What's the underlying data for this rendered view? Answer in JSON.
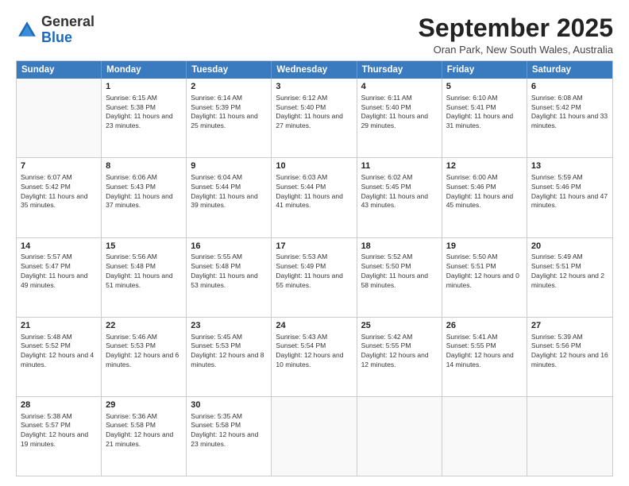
{
  "header": {
    "logo_general": "General",
    "logo_blue": "Blue",
    "month_title": "September 2025",
    "location": "Oran Park, New South Wales, Australia"
  },
  "days_of_week": [
    "Sunday",
    "Monday",
    "Tuesday",
    "Wednesday",
    "Thursday",
    "Friday",
    "Saturday"
  ],
  "weeks": [
    [
      {
        "day": "",
        "empty": true
      },
      {
        "day": "1",
        "sunrise": "Sunrise: 6:15 AM",
        "sunset": "Sunset: 5:38 PM",
        "daylight": "Daylight: 11 hours and 23 minutes."
      },
      {
        "day": "2",
        "sunrise": "Sunrise: 6:14 AM",
        "sunset": "Sunset: 5:39 PM",
        "daylight": "Daylight: 11 hours and 25 minutes."
      },
      {
        "day": "3",
        "sunrise": "Sunrise: 6:12 AM",
        "sunset": "Sunset: 5:40 PM",
        "daylight": "Daylight: 11 hours and 27 minutes."
      },
      {
        "day": "4",
        "sunrise": "Sunrise: 6:11 AM",
        "sunset": "Sunset: 5:40 PM",
        "daylight": "Daylight: 11 hours and 29 minutes."
      },
      {
        "day": "5",
        "sunrise": "Sunrise: 6:10 AM",
        "sunset": "Sunset: 5:41 PM",
        "daylight": "Daylight: 11 hours and 31 minutes."
      },
      {
        "day": "6",
        "sunrise": "Sunrise: 6:08 AM",
        "sunset": "Sunset: 5:42 PM",
        "daylight": "Daylight: 11 hours and 33 minutes."
      }
    ],
    [
      {
        "day": "7",
        "sunrise": "Sunrise: 6:07 AM",
        "sunset": "Sunset: 5:42 PM",
        "daylight": "Daylight: 11 hours and 35 minutes."
      },
      {
        "day": "8",
        "sunrise": "Sunrise: 6:06 AM",
        "sunset": "Sunset: 5:43 PM",
        "daylight": "Daylight: 11 hours and 37 minutes."
      },
      {
        "day": "9",
        "sunrise": "Sunrise: 6:04 AM",
        "sunset": "Sunset: 5:44 PM",
        "daylight": "Daylight: 11 hours and 39 minutes."
      },
      {
        "day": "10",
        "sunrise": "Sunrise: 6:03 AM",
        "sunset": "Sunset: 5:44 PM",
        "daylight": "Daylight: 11 hours and 41 minutes."
      },
      {
        "day": "11",
        "sunrise": "Sunrise: 6:02 AM",
        "sunset": "Sunset: 5:45 PM",
        "daylight": "Daylight: 11 hours and 43 minutes."
      },
      {
        "day": "12",
        "sunrise": "Sunrise: 6:00 AM",
        "sunset": "Sunset: 5:46 PM",
        "daylight": "Daylight: 11 hours and 45 minutes."
      },
      {
        "day": "13",
        "sunrise": "Sunrise: 5:59 AM",
        "sunset": "Sunset: 5:46 PM",
        "daylight": "Daylight: 11 hours and 47 minutes."
      }
    ],
    [
      {
        "day": "14",
        "sunrise": "Sunrise: 5:57 AM",
        "sunset": "Sunset: 5:47 PM",
        "daylight": "Daylight: 11 hours and 49 minutes."
      },
      {
        "day": "15",
        "sunrise": "Sunrise: 5:56 AM",
        "sunset": "Sunset: 5:48 PM",
        "daylight": "Daylight: 11 hours and 51 minutes."
      },
      {
        "day": "16",
        "sunrise": "Sunrise: 5:55 AM",
        "sunset": "Sunset: 5:48 PM",
        "daylight": "Daylight: 11 hours and 53 minutes."
      },
      {
        "day": "17",
        "sunrise": "Sunrise: 5:53 AM",
        "sunset": "Sunset: 5:49 PM",
        "daylight": "Daylight: 11 hours and 55 minutes."
      },
      {
        "day": "18",
        "sunrise": "Sunrise: 5:52 AM",
        "sunset": "Sunset: 5:50 PM",
        "daylight": "Daylight: 11 hours and 58 minutes."
      },
      {
        "day": "19",
        "sunrise": "Sunrise: 5:50 AM",
        "sunset": "Sunset: 5:51 PM",
        "daylight": "Daylight: 12 hours and 0 minutes."
      },
      {
        "day": "20",
        "sunrise": "Sunrise: 5:49 AM",
        "sunset": "Sunset: 5:51 PM",
        "daylight": "Daylight: 12 hours and 2 minutes."
      }
    ],
    [
      {
        "day": "21",
        "sunrise": "Sunrise: 5:48 AM",
        "sunset": "Sunset: 5:52 PM",
        "daylight": "Daylight: 12 hours and 4 minutes."
      },
      {
        "day": "22",
        "sunrise": "Sunrise: 5:46 AM",
        "sunset": "Sunset: 5:53 PM",
        "daylight": "Daylight: 12 hours and 6 minutes."
      },
      {
        "day": "23",
        "sunrise": "Sunrise: 5:45 AM",
        "sunset": "Sunset: 5:53 PM",
        "daylight": "Daylight: 12 hours and 8 minutes."
      },
      {
        "day": "24",
        "sunrise": "Sunrise: 5:43 AM",
        "sunset": "Sunset: 5:54 PM",
        "daylight": "Daylight: 12 hours and 10 minutes."
      },
      {
        "day": "25",
        "sunrise": "Sunrise: 5:42 AM",
        "sunset": "Sunset: 5:55 PM",
        "daylight": "Daylight: 12 hours and 12 minutes."
      },
      {
        "day": "26",
        "sunrise": "Sunrise: 5:41 AM",
        "sunset": "Sunset: 5:55 PM",
        "daylight": "Daylight: 12 hours and 14 minutes."
      },
      {
        "day": "27",
        "sunrise": "Sunrise: 5:39 AM",
        "sunset": "Sunset: 5:56 PM",
        "daylight": "Daylight: 12 hours and 16 minutes."
      }
    ],
    [
      {
        "day": "28",
        "sunrise": "Sunrise: 5:38 AM",
        "sunset": "Sunset: 5:57 PM",
        "daylight": "Daylight: 12 hours and 19 minutes."
      },
      {
        "day": "29",
        "sunrise": "Sunrise: 5:36 AM",
        "sunset": "Sunset: 5:58 PM",
        "daylight": "Daylight: 12 hours and 21 minutes."
      },
      {
        "day": "30",
        "sunrise": "Sunrise: 5:35 AM",
        "sunset": "Sunset: 5:58 PM",
        "daylight": "Daylight: 12 hours and 23 minutes."
      },
      {
        "day": "",
        "empty": true
      },
      {
        "day": "",
        "empty": true
      },
      {
        "day": "",
        "empty": true
      },
      {
        "day": "",
        "empty": true
      }
    ]
  ]
}
